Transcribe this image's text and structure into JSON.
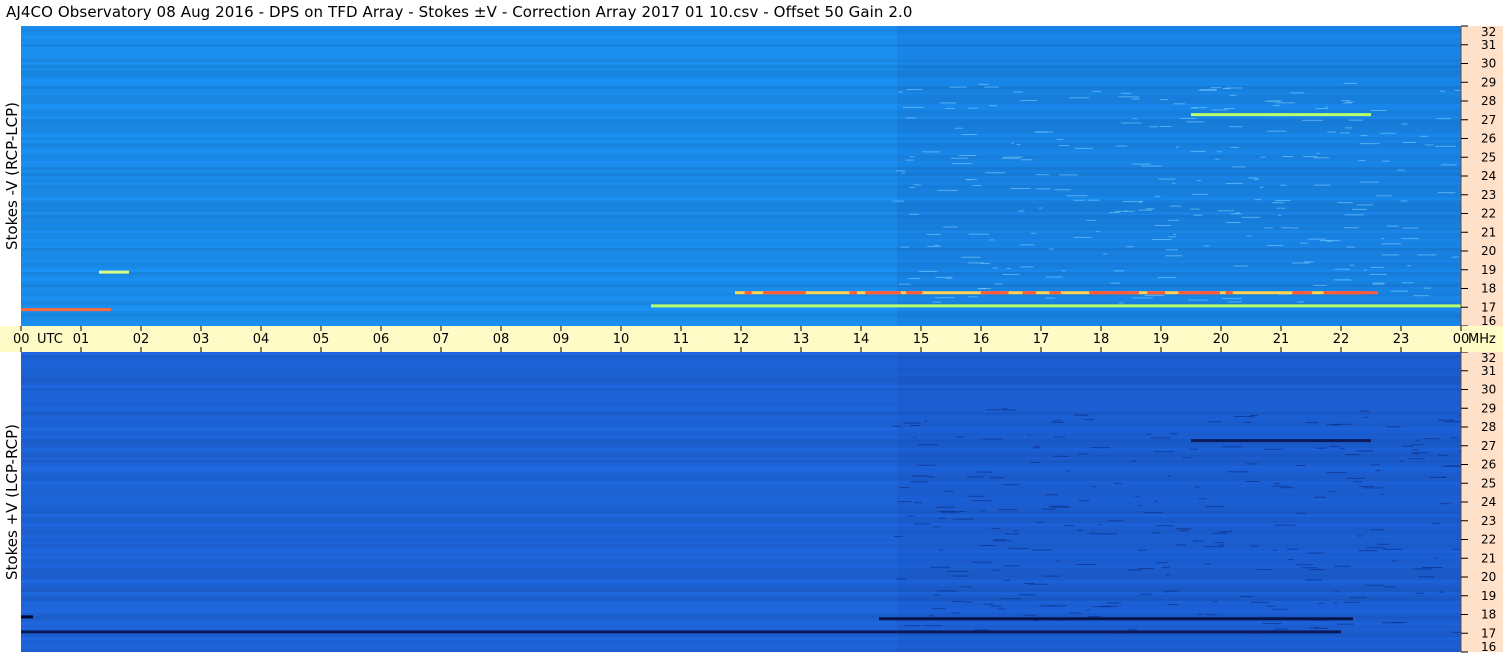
{
  "title": "AJ4CO Observatory  08 Aug 2016  -  DPS on TFD Array  -  Stokes ±V  -  Correction Array 2017 01 10.csv  -  Offset 50  Gain 2.0",
  "chart_data": [
    {
      "type": "heatmap",
      "name": "Stokes -V (RCP-LCP)",
      "ylabel": "Stokes -V (RCP-LCP)",
      "x_range_utc_hours": [
        0,
        24
      ],
      "y_range_mhz": [
        16,
        32
      ],
      "base_color": "#1a8be8",
      "features": [
        {
          "freq_mhz": 17.8,
          "start_utc": 11.9,
          "end_utc": 22.3,
          "color": "#ffd34d",
          "hot_color": "#ff5a3c"
        },
        {
          "freq_mhz": 17.1,
          "start_utc": 10.5,
          "end_utc": 24.0,
          "color": "#b8ff6a"
        },
        {
          "freq_mhz": 16.9,
          "start_utc": 0.0,
          "end_utc": 1.5,
          "color": "#ff6a3c"
        },
        {
          "freq_mhz": 18.9,
          "start_utc": 1.3,
          "end_utc": 1.8,
          "color": "#d8ff88"
        },
        {
          "freq_mhz": 27.3,
          "start_utc": 19.5,
          "end_utc": 22.5,
          "color": "#b8ff6a"
        }
      ]
    },
    {
      "type": "heatmap",
      "name": "Stokes +V (LCP-RCP)",
      "ylabel": "Stokes +V (LCP-RCP)",
      "x_range_utc_hours": [
        0,
        24
      ],
      "y_range_mhz": [
        16,
        32
      ],
      "base_color": "#1d63d6",
      "features": [
        {
          "freq_mhz": 17.8,
          "start_utc": 14.3,
          "end_utc": 22.2,
          "color": "#08154a"
        },
        {
          "freq_mhz": 17.1,
          "start_utc": 0.0,
          "end_utc": 22.0,
          "color": "#0a1a5a"
        },
        {
          "freq_mhz": 17.9,
          "start_utc": 0.0,
          "end_utc": 0.2,
          "color": "#020a30"
        },
        {
          "freq_mhz": 27.3,
          "start_utc": 19.5,
          "end_utc": 22.5,
          "color": "#0a1a5a"
        }
      ]
    }
  ],
  "time_axis": {
    "labels": [
      "00",
      "01",
      "02",
      "03",
      "04",
      "05",
      "06",
      "07",
      "08",
      "09",
      "10",
      "11",
      "12",
      "13",
      "14",
      "15",
      "16",
      "17",
      "18",
      "19",
      "20",
      "21",
      "22",
      "23",
      "00"
    ],
    "unit": "UTC",
    "background": "#fffbc6"
  },
  "freq_axis": {
    "labels": [
      16,
      17,
      18,
      19,
      20,
      21,
      22,
      23,
      24,
      25,
      26,
      27,
      28,
      29,
      30,
      31,
      32
    ],
    "unit": "MHz",
    "background": "#ffe0c8"
  }
}
